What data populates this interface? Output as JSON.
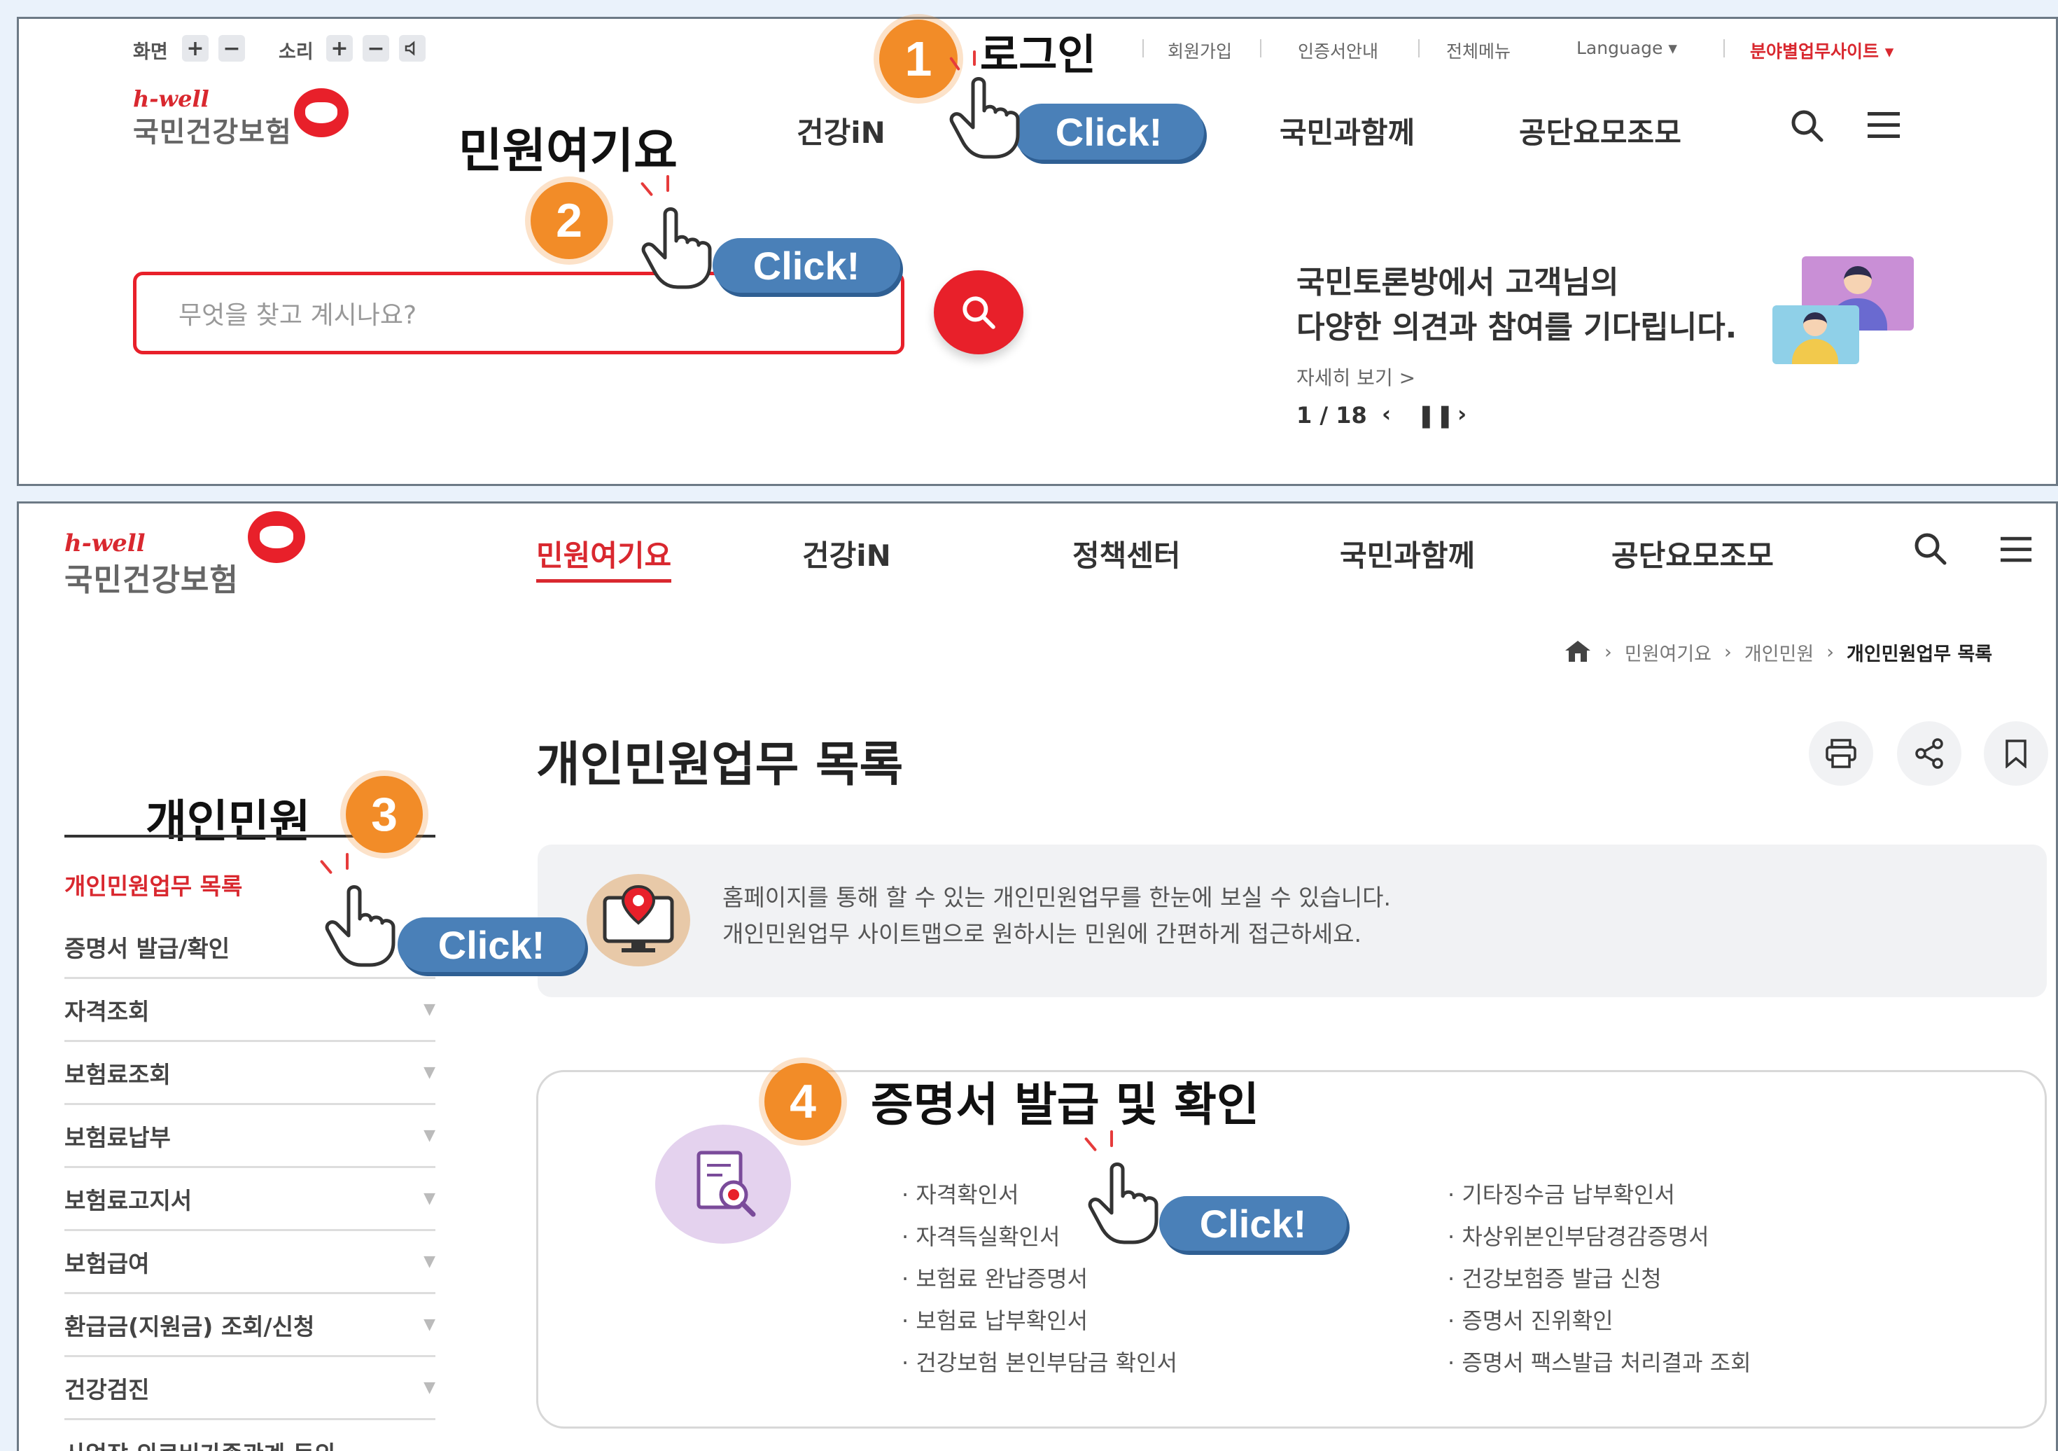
{
  "top_panel": {
    "utility": {
      "screen_label": "화면",
      "sound_label": "소리",
      "plus": "+",
      "minus": "−",
      "login": "로그인",
      "links": [
        "회원가입",
        "인증서안내",
        "전체메뉴",
        "Language ▾"
      ],
      "site_link": "분야별업무사이트 ▾"
    },
    "logo": {
      "hwell": "h-well",
      "name": "국민건강보험"
    },
    "nav": {
      "minwon": "민원여기요",
      "health_in": "건강iN",
      "together": "국민과함께",
      "about": "공단요모조모"
    },
    "search": {
      "placeholder": "무엇을 찾고 계시나요?"
    },
    "promo": {
      "line1": "국민토론방에서 고객님의",
      "line2": "다양한 의견과 참여를 기다립니다.",
      "more": "자세히 보기 >",
      "pager": "1 / 18"
    }
  },
  "bottom_panel": {
    "logo": {
      "hwell": "h-well",
      "name": "국민건강보험"
    },
    "nav": [
      "민원여기요",
      "건강iN",
      "정책센터",
      "국민과함께",
      "공단요모조모"
    ],
    "breadcrumb": [
      "민원여기요",
      "개인민원",
      "개인민원업무 목록"
    ],
    "page_title": "개인민원업무 목록",
    "sidebar": {
      "title": "개인민원",
      "items": [
        "개인민원업무 목록",
        "증명서 발급/확인",
        "자격조회",
        "보험료조회",
        "보험료납부",
        "보험료고지서",
        "보험급여",
        "환급금(지원금) 조회/신청",
        "건강검진",
        "사업장 의료비가족관계 등의"
      ]
    },
    "info": {
      "line1": "홈페이지를 통해 할 수 있는 개인민원업무를 한눈에 보실 수 있습니다.",
      "line2": "개인민원업무 사이트맵으로 원하시는 민원에 간편하게 접근하세요."
    },
    "cert": {
      "heading": "증명서 발급 및 확인",
      "left": [
        "· 자격확인서",
        "· 자격득실확인서",
        "· 보험료 완납증명서",
        "· 보험료 납부확인서",
        "· 건강보험 본인부담금 확인서"
      ],
      "right": [
        "· 기타징수금 납부확인서",
        "· 차상위본인부담경감증명서",
        "· 건강보험증 발급 신청",
        "· 증명서 진위확인",
        "· 증명서 팩스발급 처리결과 조회"
      ]
    }
  },
  "annotations": {
    "steps": [
      "1",
      "2",
      "3",
      "4"
    ],
    "click_label": "Click!"
  },
  "colors": {
    "brand_red": "#e8202a",
    "badge_orange": "#f28c28",
    "pill_blue": "#4a80b8"
  },
  "icons": [
    "search-icon",
    "menu-icon",
    "print-icon",
    "share-icon",
    "bookmark-icon",
    "home-icon",
    "pointer-hand-icon"
  ]
}
